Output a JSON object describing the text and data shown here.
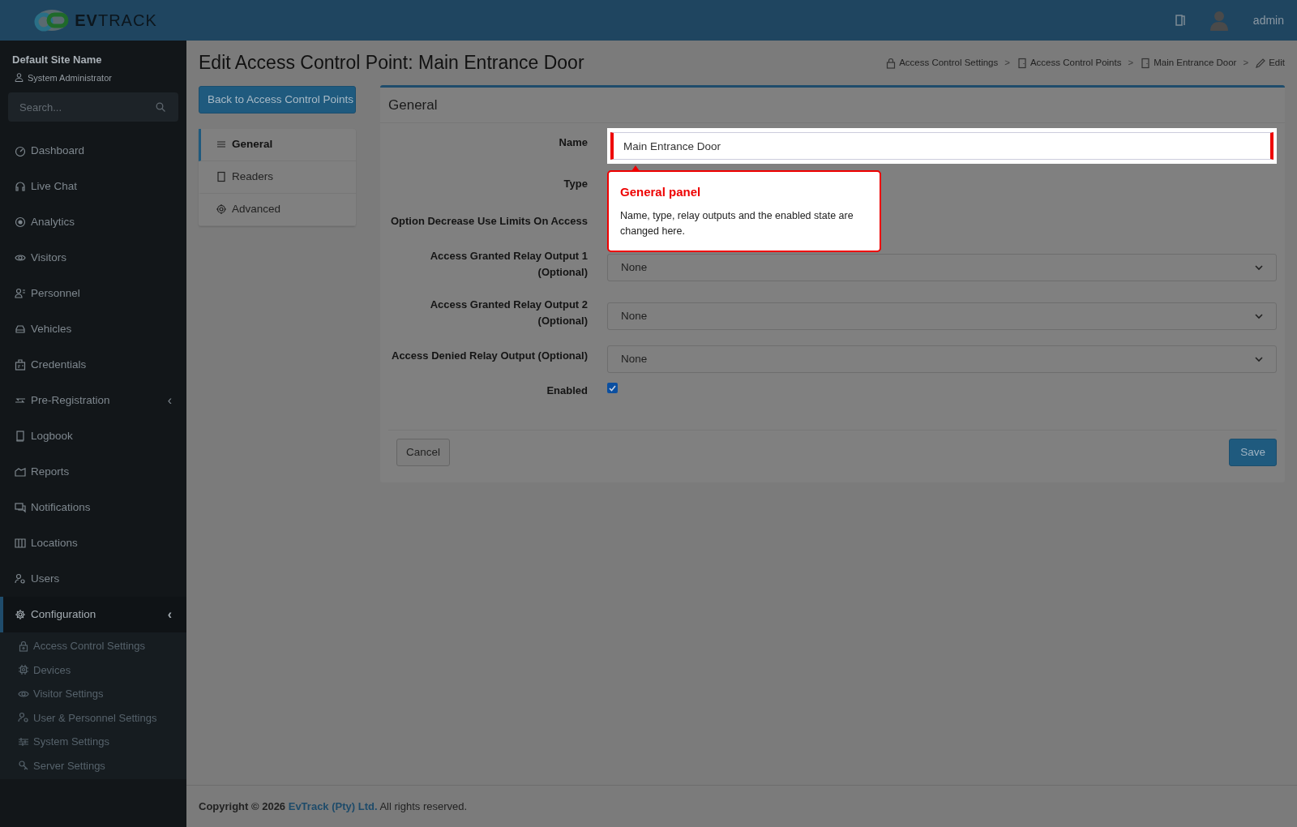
{
  "header": {
    "logo": "**EV**TRACK",
    "user": "admin"
  },
  "sidebar": {
    "site_name": "Default Site Name",
    "role": "System Administrator",
    "search": {
      "placeholder": "Search..."
    },
    "items": [
      {
        "label": "Dashboard",
        "selected": false
      },
      {
        "label": "Live Chat",
        "selected": false
      },
      {
        "label": "Analytics",
        "selected": false
      },
      {
        "label": "Visitors",
        "selected": false
      },
      {
        "label": "Personnel",
        "selected": false
      },
      {
        "label": "Vehicles",
        "selected": false
      },
      {
        "label": "Credentials",
        "selected": false
      },
      {
        "label": "Pre-Registration",
        "selected": false,
        "expanded": false,
        "caret": "‹"
      },
      {
        "label": "Logbook",
        "selected": false
      },
      {
        "label": "Reports",
        "selected": false
      },
      {
        "label": "Notifications",
        "selected": false
      },
      {
        "label": "Locations",
        "selected": false
      },
      {
        "label": "Users",
        "selected": false
      },
      {
        "label": "Configuration",
        "selected": true,
        "expanded": true,
        "caret": "‹",
        "children": [
          {
            "label": "Access Control Settings"
          },
          {
            "label": "Devices"
          },
          {
            "label": "Visitor Settings"
          },
          {
            "label": "User & Personnel Settings"
          },
          {
            "label": "System Settings"
          },
          {
            "label": "Server Settings"
          }
        ]
      }
    ]
  },
  "page": {
    "title": "Edit Access Control Point: Main Entrance Door",
    "breadcrumbs": [
      {
        "label": "Access Control Settings",
        "separator": ">"
      },
      {
        "label": "Access Control Points",
        "separator": ">"
      },
      {
        "label": "Main Entrance Door",
        "separator": ">"
      },
      {
        "label": "Edit"
      }
    ],
    "back_button": "Back to Access Control Points",
    "tabs": [
      {
        "label": "General",
        "selected": true
      },
      {
        "label": "Readers",
        "selected": false
      },
      {
        "label": "Advanced",
        "selected": false
      }
    ],
    "card": {
      "title": "General",
      "fields": [
        {
          "label": "Name",
          "kind": "text",
          "value": "Main Entrance Door",
          "highlighted": true
        },
        {
          "label": "Type",
          "kind": "covered"
        },
        {
          "label": "Option Decrease Use Limits On Access",
          "kind": "covered"
        },
        {
          "label": "Access Granted Relay Output 1 (Optional)",
          "kind": "select",
          "value": "None"
        },
        {
          "label": "Access Granted Relay Output 2 (Optional)",
          "kind": "select",
          "value": "None"
        },
        {
          "label": "Access Denied Relay Output (Optional)",
          "kind": "select",
          "value": "None"
        },
        {
          "label": "Enabled",
          "kind": "checkbox",
          "checked": true
        }
      ],
      "cancel": "Cancel",
      "save": "Save"
    }
  },
  "tour": {
    "title": "General panel",
    "text": "Name, type, relay outputs and the enabled state are changed here."
  },
  "footer": {
    "prefix": "Copyright © 2026",
    "link": "EvTrack (Pty) Ltd.",
    "suffix": "All rights reserved."
  }
}
